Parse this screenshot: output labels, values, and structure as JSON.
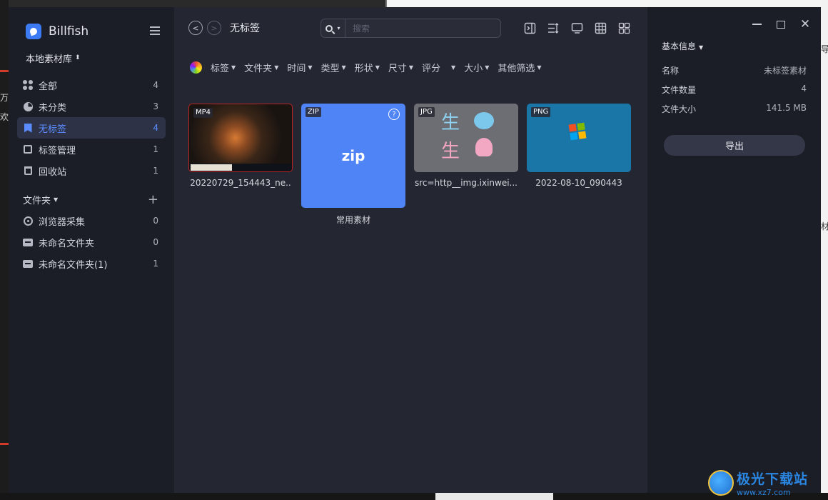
{
  "app": {
    "name": "Billfish",
    "library": "本地素材库",
    "brand_color": "#3d7bf5",
    "accent_color": "#5b8cff"
  },
  "sidebar": {
    "items": [
      {
        "label": "全部",
        "count": "4",
        "icon": "all-icon"
      },
      {
        "label": "未分类",
        "count": "3",
        "icon": "pie-icon"
      },
      {
        "label": "无标签",
        "count": "4",
        "icon": "bookmark-icon",
        "active": true
      },
      {
        "label": "标签管理",
        "count": "1",
        "icon": "tag-manage-icon"
      },
      {
        "label": "回收站",
        "count": "1",
        "icon": "trash-icon"
      }
    ],
    "folder_header": "文件夹",
    "folders": [
      {
        "label": "浏览器采集",
        "count": "0",
        "icon": "globe-icon"
      },
      {
        "label": "未命名文件夹",
        "count": "0",
        "icon": "folder-icon"
      },
      {
        "label": "未命名文件夹(1)",
        "count": "1",
        "icon": "folder-icon"
      }
    ]
  },
  "toolbar": {
    "breadcrumb": "无标签",
    "search_placeholder": "搜索"
  },
  "filters": [
    "标签",
    "文件夹",
    "时间",
    "类型",
    "形状",
    "尺寸",
    "评分",
    "",
    "大小",
    "其他筛选"
  ],
  "items": [
    {
      "format": "MP4",
      "name": "20220729_154443_ne.."
    },
    {
      "format": "ZIP",
      "name": "常用素材",
      "big_label": "zip"
    },
    {
      "format": "JPG",
      "name": "src=http__img.ixinwei...",
      "glyph": "生"
    },
    {
      "format": "PNG",
      "name": "2022-08-10_090443"
    }
  ],
  "panel": {
    "title": "基本信息",
    "rows": [
      {
        "label": "名称",
        "value": "未标签素材"
      },
      {
        "label": "文件数量",
        "value": "4"
      },
      {
        "label": "文件大小",
        "value": "141.5 MB"
      }
    ],
    "export_label": "导出"
  },
  "watermark": {
    "title": "极光下载站",
    "url": "www.xz7.com"
  }
}
